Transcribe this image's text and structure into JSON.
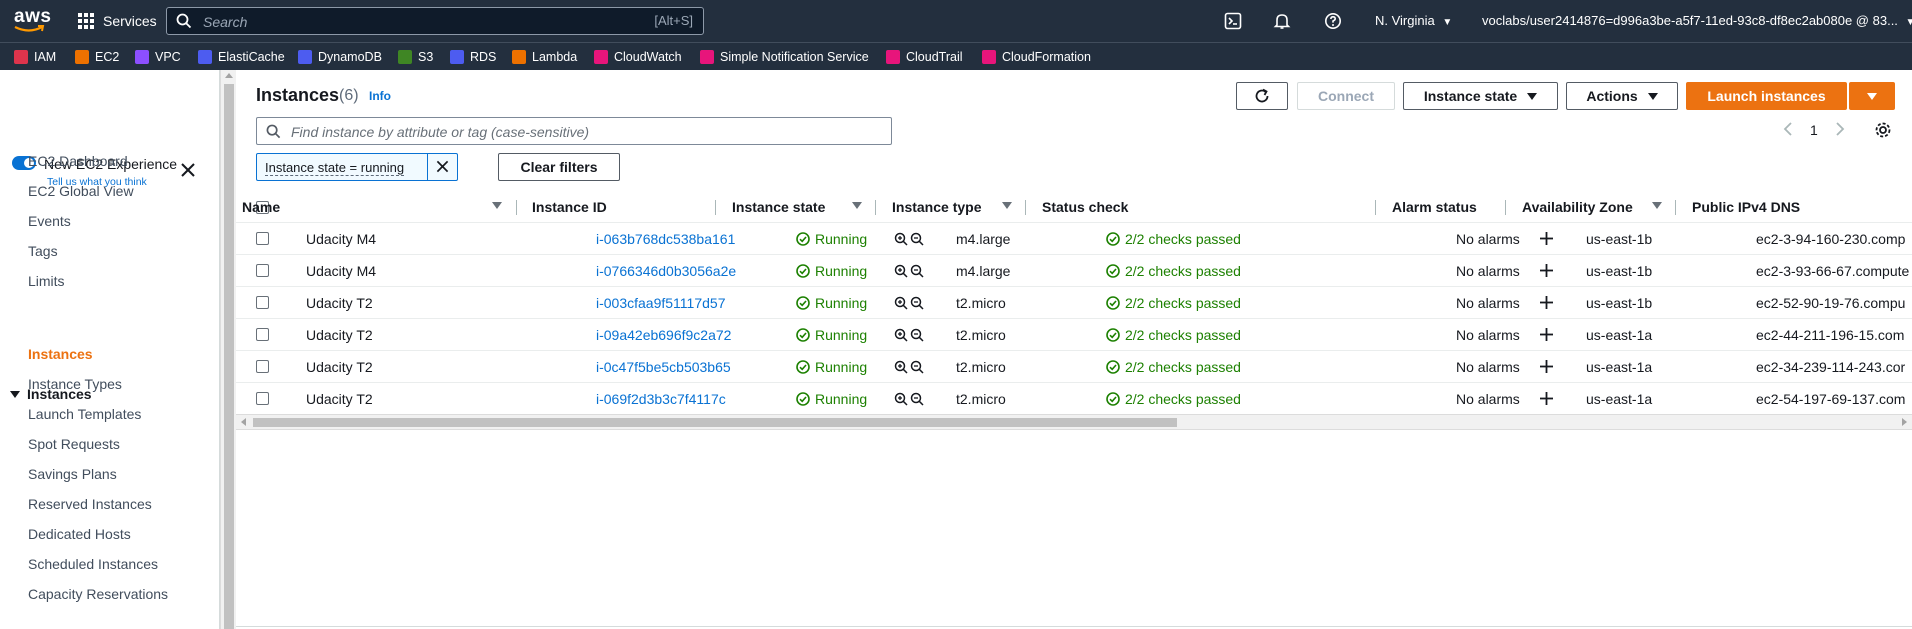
{
  "topbar": {
    "logo_text": "aws",
    "services_label": "Services",
    "search_placeholder": "Search",
    "search_shortcut": "[Alt+S]",
    "region": "N. Virginia",
    "account": "voclabs/user2414876=d996a3be-a5f7-11ed-93c8-df8ec2ab080e @ 83..."
  },
  "favorites": [
    {
      "label": "IAM",
      "color": "#dd344c"
    },
    {
      "label": "EC2",
      "color": "#ed7100"
    },
    {
      "label": "VPC",
      "color": "#8c4fff"
    },
    {
      "label": "ElastiCache",
      "color": "#4d5cf0"
    },
    {
      "label": "DynamoDB",
      "color": "#4d5cf0"
    },
    {
      "label": "S3",
      "color": "#3f8624"
    },
    {
      "label": "RDS",
      "color": "#4d5cf0"
    },
    {
      "label": "Lambda",
      "color": "#ed7100"
    },
    {
      "label": "CloudWatch",
      "color": "#e7157b"
    },
    {
      "label": "Simple Notification Service",
      "color": "#e7157b"
    },
    {
      "label": "CloudTrail",
      "color": "#e7157b"
    },
    {
      "label": "CloudFormation",
      "color": "#e7157b"
    }
  ],
  "sidebar": {
    "new_experience": "New EC2 Experience",
    "tell_us": "Tell us what you think",
    "items": [
      {
        "label": "EC2 Dashboard"
      },
      {
        "label": "EC2 Global View"
      },
      {
        "label": "Events"
      },
      {
        "label": "Tags"
      },
      {
        "label": "Limits"
      }
    ],
    "section": "Instances",
    "section_items": [
      {
        "label": "Instances",
        "active": true
      },
      {
        "label": "Instance Types"
      },
      {
        "label": "Launch Templates"
      },
      {
        "label": "Spot Requests"
      },
      {
        "label": "Savings Plans"
      },
      {
        "label": "Reserved Instances"
      },
      {
        "label": "Dedicated Hosts"
      },
      {
        "label": "Scheduled Instances"
      },
      {
        "label": "Capacity Reservations"
      }
    ]
  },
  "main": {
    "title": "Instances",
    "count": "(6)",
    "info": "Info",
    "buttons": {
      "connect": "Connect",
      "instance_state": "Instance state",
      "actions": "Actions",
      "launch": "Launch instances"
    },
    "filter_placeholder": "Find instance by attribute or tag (case-sensitive)",
    "filter_token": "Instance state = running",
    "clear_filters": "Clear filters",
    "page": "1"
  },
  "table": {
    "columns": [
      "Name",
      "Instance ID",
      "Instance state",
      "Instance type",
      "Status check",
      "Alarm status",
      "Availability Zone",
      "Public IPv4 DNS"
    ],
    "rows": [
      {
        "name": "Udacity M4",
        "id": "i-063b768dc538ba161",
        "state": "Running",
        "type": "m4.large",
        "status": "2/2 checks passed",
        "alarm": "No alarms",
        "az": "us-east-1b",
        "dns": "ec2-3-94-160-230.comp"
      },
      {
        "name": "Udacity M4",
        "id": "i-0766346d0b3056a2e",
        "state": "Running",
        "type": "m4.large",
        "status": "2/2 checks passed",
        "alarm": "No alarms",
        "az": "us-east-1b",
        "dns": "ec2-3-93-66-67.compute"
      },
      {
        "name": "Udacity T2",
        "id": "i-003cfaa9f51117d57",
        "state": "Running",
        "type": "t2.micro",
        "status": "2/2 checks passed",
        "alarm": "No alarms",
        "az": "us-east-1b",
        "dns": "ec2-52-90-19-76.compu"
      },
      {
        "name": "Udacity T2",
        "id": "i-09a42eb696f9c2a72",
        "state": "Running",
        "type": "t2.micro",
        "status": "2/2 checks passed",
        "alarm": "No alarms",
        "az": "us-east-1a",
        "dns": "ec2-44-211-196-15.com"
      },
      {
        "name": "Udacity T2",
        "id": "i-0c47f5be5cb503b65",
        "state": "Running",
        "type": "t2.micro",
        "status": "2/2 checks passed",
        "alarm": "No alarms",
        "az": "us-east-1a",
        "dns": "ec2-34-239-114-243.cor"
      },
      {
        "name": "Udacity T2",
        "id": "i-069f2d3b3c7f4117c",
        "state": "Running",
        "type": "t2.micro",
        "status": "2/2 checks passed",
        "alarm": "No alarms",
        "az": "us-east-1a",
        "dns": "ec2-54-197-69-137.com"
      }
    ]
  }
}
